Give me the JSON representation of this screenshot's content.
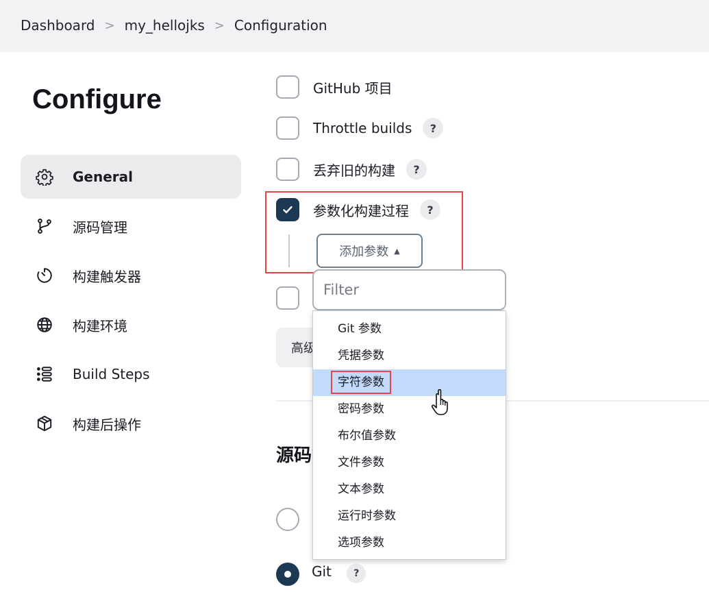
{
  "breadcrumb": {
    "items": [
      "Dashboard",
      "my_hellojks",
      "Configuration"
    ],
    "separator": ">"
  },
  "page": {
    "title": "Configure"
  },
  "sidebar": {
    "items": [
      {
        "label": "General",
        "icon": "gear-icon",
        "active": true
      },
      {
        "label": "源码管理",
        "icon": "branch-icon"
      },
      {
        "label": "构建触发器",
        "icon": "timer-icon"
      },
      {
        "label": "构建环境",
        "icon": "globe-icon"
      },
      {
        "label": "Build Steps",
        "icon": "list-icon"
      },
      {
        "label": "构建后操作",
        "icon": "cube-icon"
      }
    ]
  },
  "general": {
    "options": [
      {
        "label": "GitHub 项目",
        "checked": false
      },
      {
        "label": "Throttle builds",
        "checked": false,
        "help": "?"
      },
      {
        "label": "丢弃旧的构建",
        "checked": false,
        "help": "?"
      },
      {
        "label": "参数化构建过程",
        "checked": true,
        "help": "?"
      }
    ],
    "add_param_label": "添加参数",
    "filter_placeholder": "Filter",
    "advanced_label": "高级"
  },
  "param_menu": {
    "items": [
      "Git 参数",
      "凭据参数",
      "字符参数",
      "密码参数",
      "布尔值参数",
      "文件参数",
      "文本参数",
      "运行时参数",
      "选项参数"
    ],
    "highlighted": "字符参数"
  },
  "scm": {
    "section_title": "源码管理",
    "git_label": "Git",
    "git_selected": true,
    "help": "?"
  },
  "colors": {
    "checked_fill": "#1c3853",
    "highlight_box": "#e34848",
    "menu_hover": "#c2dafc"
  }
}
